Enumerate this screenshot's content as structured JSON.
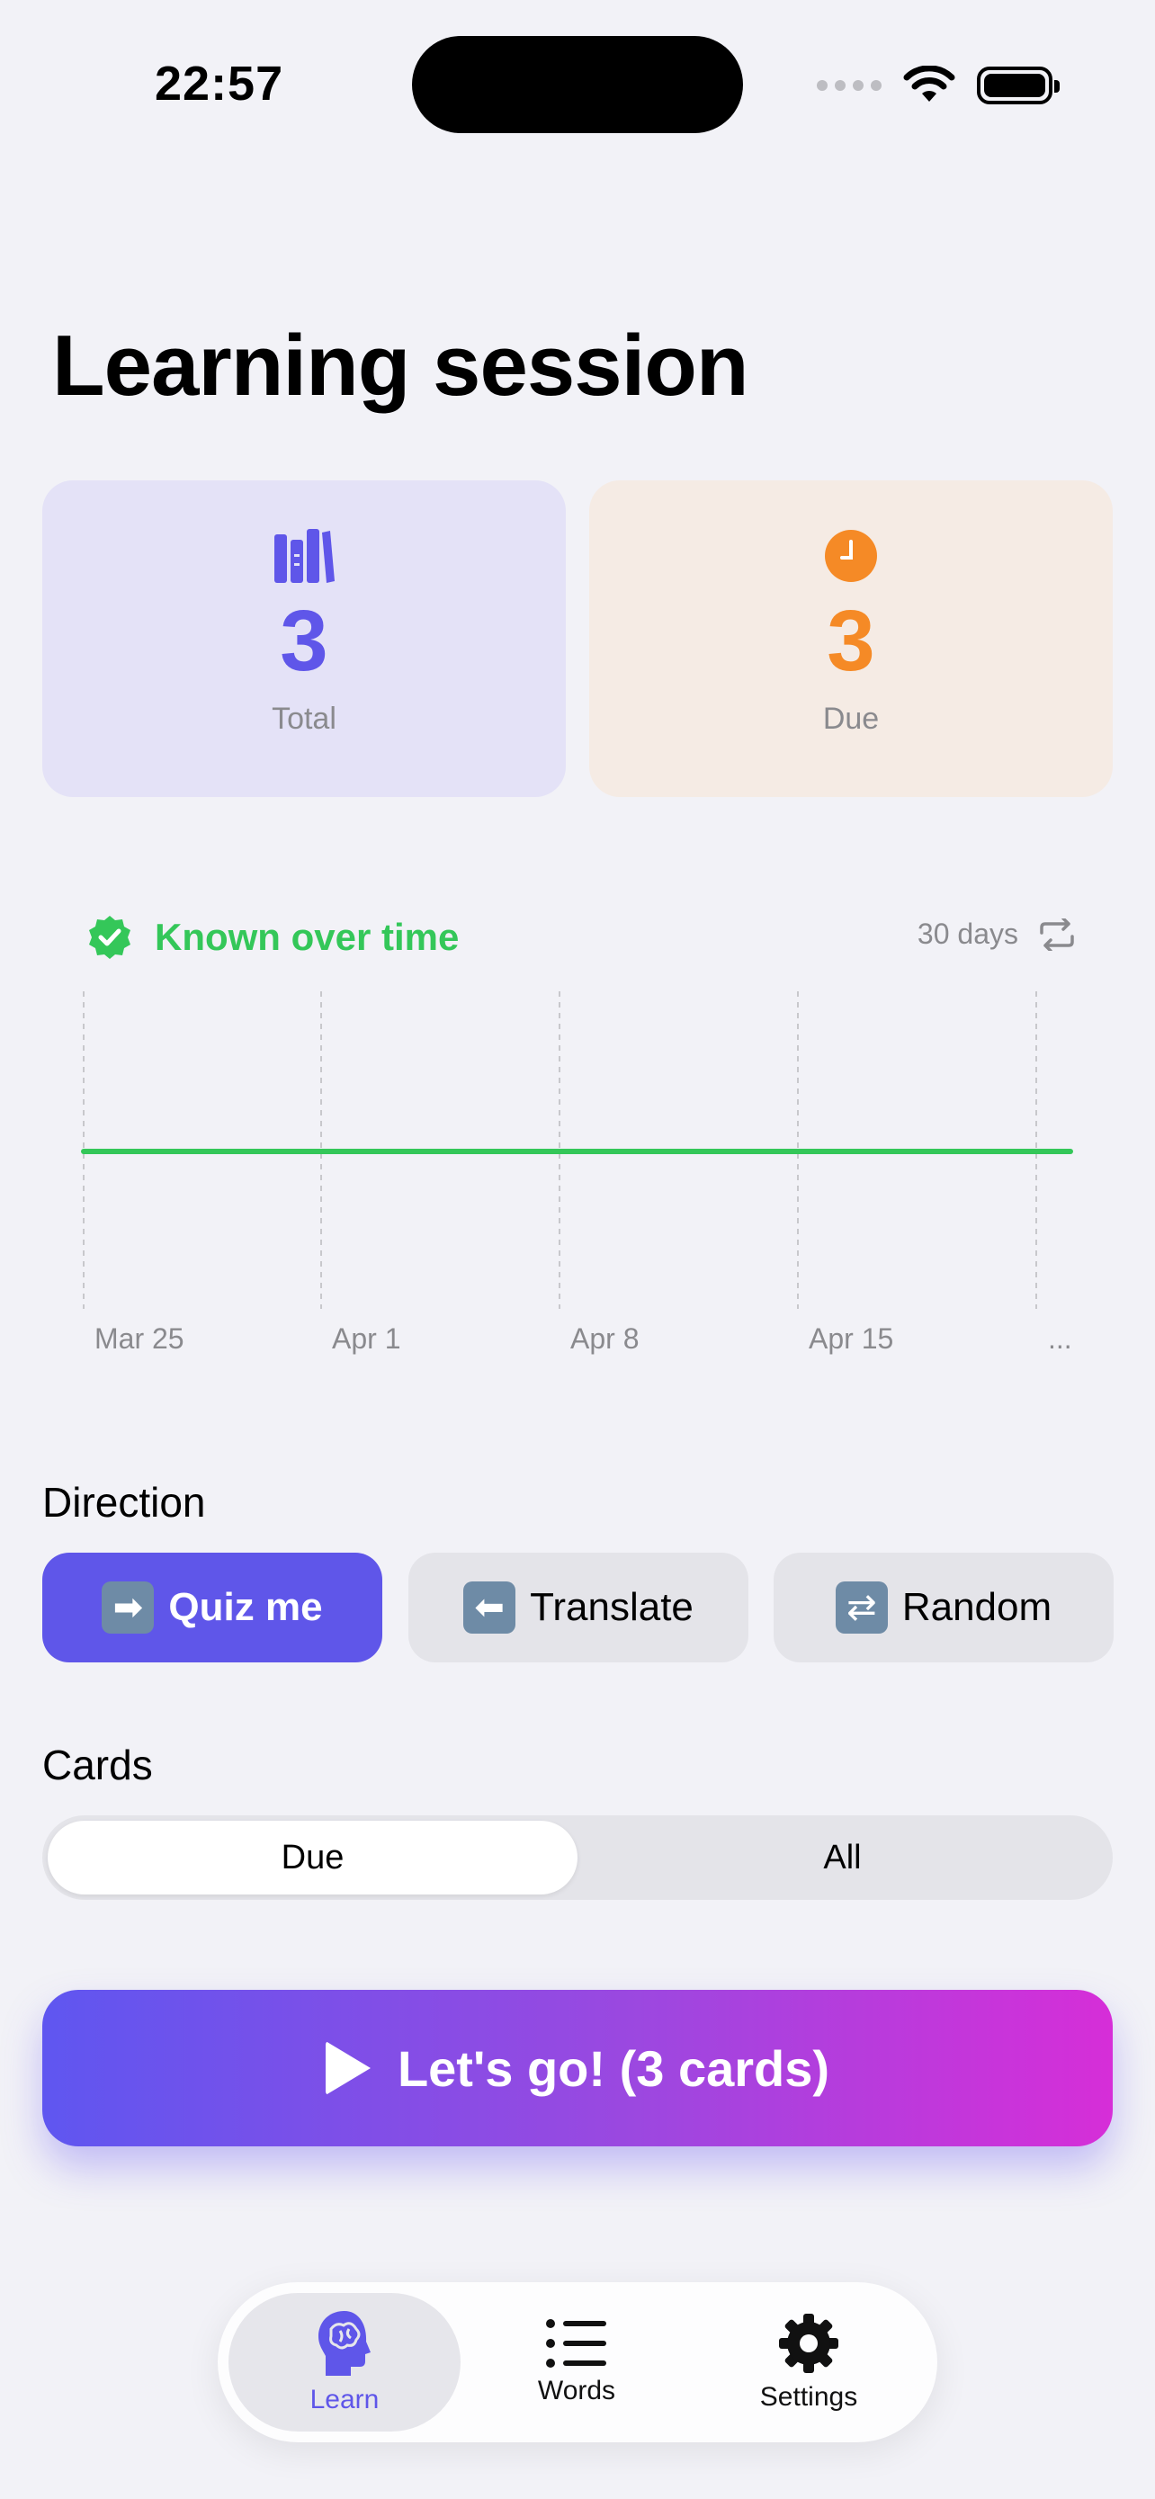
{
  "status_bar": {
    "time": "22:57"
  },
  "page": {
    "title": "Learning session"
  },
  "stats": {
    "total": {
      "value": "3",
      "label": "Total",
      "icon": "books-icon",
      "color": "#5f56e9"
    },
    "due": {
      "value": "3",
      "label": "Due",
      "icon": "clock-icon",
      "color": "#f58a26"
    }
  },
  "chart_section": {
    "title": "Known over time",
    "range": "30 days",
    "icon": "checkmark-seal-icon",
    "toggle_icon": "repeat-icon"
  },
  "chart_data": {
    "type": "line",
    "title": "Known over time",
    "x_tick_labels": [
      "Mar 25",
      "Apr 1",
      "Apr 8",
      "Apr 15",
      "..."
    ],
    "series": [
      {
        "values": [
          0,
          0,
          0,
          0,
          0
        ]
      }
    ],
    "grid": "vertical dashed",
    "color": "#34c759"
  },
  "direction": {
    "label": "Direction",
    "options": [
      {
        "emoji": "➡",
        "label": "Quiz me",
        "selected": true
      },
      {
        "emoji": "⬅",
        "label": "Translate",
        "selected": false
      },
      {
        "emoji": "⇄",
        "label": "Random",
        "selected": false
      }
    ]
  },
  "cards": {
    "label": "Cards",
    "options": [
      {
        "label": "Due",
        "selected": true
      },
      {
        "label": "All",
        "selected": false
      }
    ]
  },
  "cta": {
    "label": "Let's go! (3 cards)",
    "icon": "play-icon"
  },
  "tabbar": {
    "items": [
      {
        "label": "Learn",
        "icon": "brain-head-icon",
        "active": true
      },
      {
        "label": "Words",
        "icon": "list-icon",
        "active": false
      },
      {
        "label": "Settings",
        "icon": "gear-icon",
        "active": false
      }
    ]
  },
  "colors": {
    "accent": "#5f56e9",
    "success": "#34c759",
    "warning": "#f58a26",
    "background": "#f2f2f7"
  }
}
